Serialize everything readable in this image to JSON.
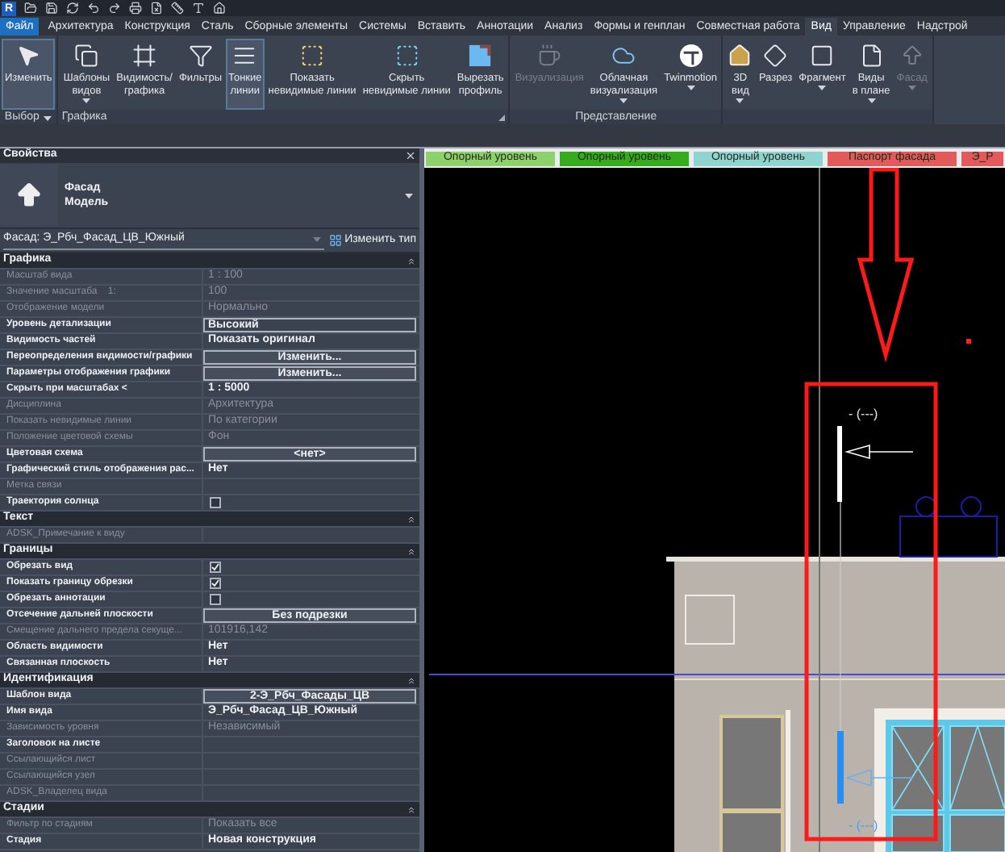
{
  "app_logo": "R",
  "ribbon_tabs": [
    {
      "label": "Файл",
      "kind": "file",
      "selected": false
    },
    {
      "label": "Архитектура",
      "kind": "tab",
      "selected": false
    },
    {
      "label": "Конструкция",
      "kind": "tab",
      "selected": false
    },
    {
      "label": "Сталь",
      "kind": "tab",
      "selected": false
    },
    {
      "label": "Сборные элементы",
      "kind": "tab",
      "selected": false
    },
    {
      "label": "Системы",
      "kind": "tab",
      "selected": false
    },
    {
      "label": "Вставить",
      "kind": "tab",
      "selected": false
    },
    {
      "label": "Аннотации",
      "kind": "tab",
      "selected": false
    },
    {
      "label": "Анализ",
      "kind": "tab",
      "selected": false
    },
    {
      "label": "Формы и генплан",
      "kind": "tab",
      "selected": false
    },
    {
      "label": "Совместная работа",
      "kind": "tab",
      "selected": false
    },
    {
      "label": "Вид",
      "kind": "tab",
      "selected": true
    },
    {
      "label": "Управление",
      "kind": "tab",
      "selected": false
    },
    {
      "label": "Надстрой",
      "kind": "tab",
      "selected": false
    }
  ],
  "ribbon_panels": [
    {
      "title": "Выбор",
      "menu": true,
      "launcher": false,
      "buttons": [
        {
          "label": "Изменить",
          "selected": true,
          "disabled": false,
          "dropdown": false
        }
      ]
    },
    {
      "title": "Графика",
      "menu": false,
      "launcher": true,
      "buttons": [
        {
          "label": "Шаблоны\nвидов",
          "selected": false,
          "disabled": false,
          "dropdown": true
        },
        {
          "label": "Видимость/\nграфика",
          "selected": false,
          "disabled": false,
          "dropdown": false
        },
        {
          "label": "Фильтры",
          "selected": false,
          "disabled": false,
          "dropdown": false
        },
        {
          "label": "Тонкие\nлинии",
          "selected": true,
          "disabled": false,
          "dropdown": false
        },
        {
          "label": "Показать\nневидимые линии",
          "selected": false,
          "disabled": false,
          "dropdown": false
        },
        {
          "label": "Скрыть\nневидимые линии",
          "selected": false,
          "disabled": false,
          "dropdown": false
        },
        {
          "label": "Вырезать\nпрофиль",
          "selected": false,
          "disabled": false,
          "dropdown": false
        }
      ]
    },
    {
      "title": "Представление",
      "menu": false,
      "launcher": false,
      "buttons": [
        {
          "label": "Визуализация",
          "selected": false,
          "disabled": true,
          "dropdown": false
        },
        {
          "label": "Облачная\nвизуализация",
          "selected": false,
          "disabled": false,
          "dropdown": true
        },
        {
          "label": "Twinmotion",
          "selected": false,
          "disabled": false,
          "dropdown": true
        }
      ]
    },
    {
      "buttons": [
        {
          "label": "3D\nвид",
          "selected": false,
          "disabled": false,
          "dropdown": true
        },
        {
          "label": "Разрез",
          "selected": false,
          "disabled": false,
          "dropdown": false
        },
        {
          "label": "Фрагмент",
          "selected": false,
          "disabled": false,
          "dropdown": true
        },
        {
          "label": "Виды\nв плане",
          "selected": false,
          "disabled": false,
          "dropdown": true
        },
        {
          "label": "Фасад",
          "selected": false,
          "disabled": true,
          "dropdown": true
        }
      ]
    }
  ],
  "properties": {
    "title": "Свойства",
    "type_name": "Фасад",
    "type_family": "Модель",
    "instance": "Фасад: Э_Рбч_Фасад_ЦВ_Южный",
    "edit_type": "Изменить тип",
    "sections": [
      {
        "title": "Графика",
        "rows": [
          {
            "label": "Масштаб вида",
            "kind": "text",
            "value": "1 : 100",
            "disabled": true
          },
          {
            "label": "Значение масштаба    1:",
            "kind": "text",
            "value": "100",
            "disabled": true
          },
          {
            "label": "Отображение модели",
            "kind": "text",
            "value": "Нормально",
            "disabled": true
          },
          {
            "label": "Уровень детализации",
            "kind": "input",
            "value": "Высокий",
            "disabled": false
          },
          {
            "label": "Видимость частей",
            "kind": "text",
            "value": "Показать оригинал",
            "disabled": false
          },
          {
            "label": "Переопределения видимости/графики",
            "kind": "button",
            "value": "Изменить...",
            "disabled": false
          },
          {
            "label": "Параметры отображения графики",
            "kind": "button",
            "value": "Изменить...",
            "disabled": false
          },
          {
            "label": "Скрыть при масштабах <",
            "kind": "text",
            "value": "1 : 5000",
            "disabled": false
          },
          {
            "label": "Дисциплина",
            "kind": "text",
            "value": "Архитектура",
            "disabled": true
          },
          {
            "label": "Показать невидимые линии",
            "kind": "text",
            "value": "По категории",
            "disabled": true
          },
          {
            "label": "Положение цветовой схемы",
            "kind": "text",
            "value": "Фон",
            "disabled": true
          },
          {
            "label": "Цветовая схема",
            "kind": "button",
            "value": "<нет>",
            "disabled": false
          },
          {
            "label": "Графический стиль отображения рас...",
            "kind": "text",
            "value": "Нет",
            "disabled": false
          },
          {
            "label": "Метка связи",
            "kind": "text",
            "disabled": true
          },
          {
            "label": "Траектория солнца",
            "kind": "checkbox",
            "checked": false,
            "disabled": false
          }
        ]
      },
      {
        "title": "Текст",
        "rows": [
          {
            "label": "ADSK_Примечание к виду",
            "kind": "text",
            "disabled": true
          }
        ]
      },
      {
        "title": "Границы",
        "rows": [
          {
            "label": "Обрезать вид",
            "kind": "checkbox",
            "checked": true,
            "disabled": false
          },
          {
            "label": "Показать границу обрезки",
            "kind": "checkbox",
            "checked": true,
            "disabled": false
          },
          {
            "label": "Обрезать аннотации",
            "kind": "checkbox",
            "checked": false,
            "disabled": false
          },
          {
            "label": "Отсечение дальней плоскости",
            "kind": "button",
            "value": "Без подрезки",
            "disabled": false
          },
          {
            "label": "Смещение дальнего предела секуще...",
            "kind": "text",
            "value": "101916,142",
            "disabled": true
          },
          {
            "label": "Область видимости",
            "kind": "text",
            "value": "Нет",
            "disabled": false
          },
          {
            "label": "Связанная плоскость",
            "kind": "text",
            "value": "Нет",
            "disabled": false
          }
        ]
      },
      {
        "title": "Идентификация",
        "rows": [
          {
            "label": "Шаблон вида",
            "kind": "button",
            "value": "2-Э_Рбч_Фасады_ЦВ",
            "disabled": false
          },
          {
            "label": "Имя вида",
            "kind": "text",
            "value": "Э_Рбч_Фасад_ЦВ_Южный",
            "disabled": false
          },
          {
            "label": "Зависимость уровня",
            "kind": "text",
            "value": "Независимый",
            "disabled": true
          },
          {
            "label": "Заголовок на листе",
            "kind": "text",
            "disabled": false
          },
          {
            "label": "Ссылающийся лист",
            "kind": "text",
            "disabled": true
          },
          {
            "label": "Ссылающийся узел",
            "kind": "text",
            "disabled": true
          },
          {
            "label": "ADSK_Владелец вида",
            "kind": "text",
            "disabled": true
          }
        ]
      },
      {
        "title": "Стадии",
        "rows": [
          {
            "label": "Фильтр по стадиям",
            "kind": "text",
            "value": "Показать все",
            "disabled": true
          },
          {
            "label": "Стадия",
            "kind": "text",
            "value": "Новая конструкция",
            "disabled": false
          }
        ]
      }
    ]
  },
  "view_tabs": [
    {
      "label": "Опорный уровень",
      "color": "#8ed16b"
    },
    {
      "label": "Опорный уровень",
      "color": "#36ab1c"
    },
    {
      "label": "Опорный уровень",
      "color": "#90d4cf"
    },
    {
      "label": "Паспорт фасада",
      "color": "#e25a5a"
    },
    {
      "label": "Э_Р",
      "color": "#e25a5a"
    }
  ],
  "level_tags": [
    {
      "text": "- (---)",
      "selected": false
    },
    {
      "text": "- (---)",
      "selected": true
    }
  ]
}
